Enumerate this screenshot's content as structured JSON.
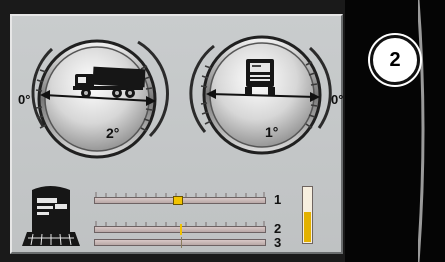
{
  "gauges": {
    "left": {
      "zero_label": "0°",
      "value_label": "2°",
      "icon": "truck-side-icon"
    },
    "right": {
      "zero_label": "0°",
      "value_label": "1°",
      "icon": "truck-front-icon"
    }
  },
  "sliders": [
    {
      "label": "1",
      "value": 0.48
    },
    {
      "label": "2",
      "value": 0.5
    },
    {
      "label": "3",
      "value": 0.5
    }
  ],
  "level": {
    "value": 0.55,
    "color": "#e3b100"
  },
  "vehicle_icon": "harvester-front-icon",
  "badge": {
    "value": "2"
  },
  "colors": {
    "accent": "#f2c300",
    "panel": "#c4c7c8"
  }
}
